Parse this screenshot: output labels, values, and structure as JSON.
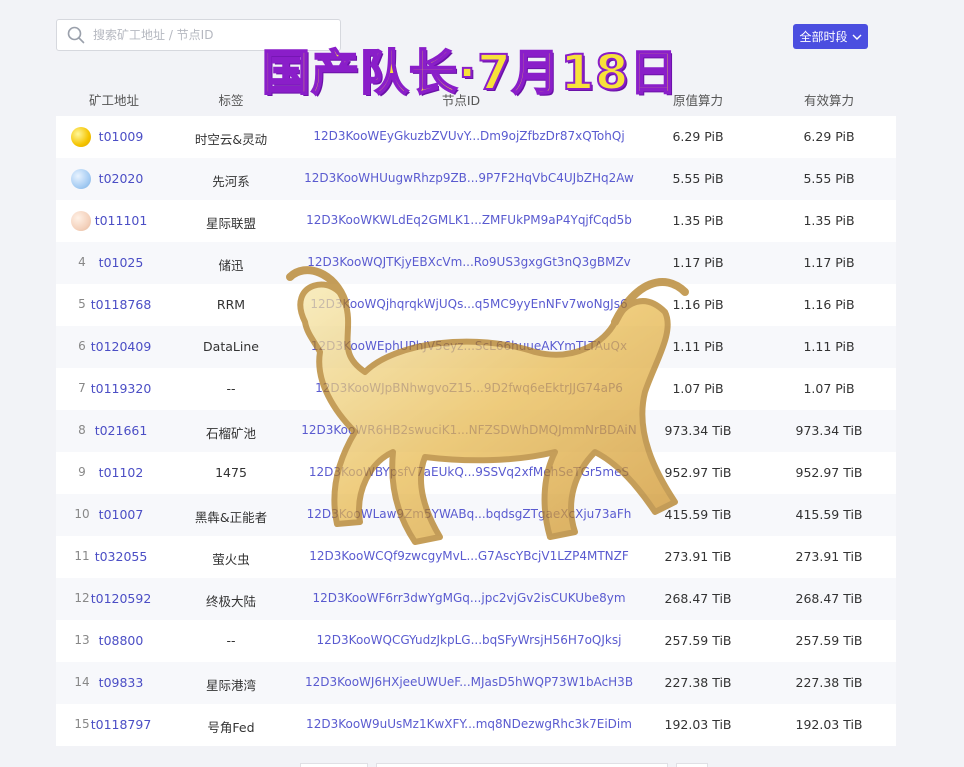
{
  "search": {
    "placeholder": "搜索矿工地址 / 节点ID"
  },
  "overlay_title": "国产队长·7月18日",
  "period_button": {
    "label": "全部时段"
  },
  "columns": {
    "miner": "矿工地址",
    "tag": "标签",
    "node": "节点ID",
    "raw": "原值算力",
    "effective": "有效算力"
  },
  "rows": [
    {
      "rank": "1",
      "miner": "t01009",
      "tag": "时空云&灵动",
      "node": "12D3KooWEyGkuzbZVUvY...Dm9ojZfbzDr87xQTohQj",
      "raw": "6.29 PiB",
      "effective": "6.29 PiB"
    },
    {
      "rank": "2",
      "miner": "t02020",
      "tag": "先河系",
      "node": "12D3KooWHUugwRhzp9ZB...9P7F2HqVbC4UJbZHq2Aw",
      "raw": "5.55 PiB",
      "effective": "5.55 PiB"
    },
    {
      "rank": "3",
      "miner": "t011101",
      "tag": "星际联盟",
      "node": "12D3KooWKWLdEq2GMLK1...ZMFUkPM9aP4YqjfCqd5b",
      "raw": "1.35 PiB",
      "effective": "1.35 PiB"
    },
    {
      "rank": "4",
      "miner": "t01025",
      "tag": "储迅",
      "node": "12D3KooWQJTKjyEBXcVm...Ro9US3gxgGt3nQ3gBMZv",
      "raw": "1.17 PiB",
      "effective": "1.17 PiB"
    },
    {
      "rank": "5",
      "miner": "t0118768",
      "tag": "RRM",
      "node": "12D3KooWQjhqrqkWjUQs...q5MC9yyEnNFv7woNgJs6",
      "raw": "1.16 PiB",
      "effective": "1.16 PiB"
    },
    {
      "rank": "6",
      "miner": "t0120409",
      "tag": "DataLine",
      "node": "12D3KooWEphUPhJV5eyz...ScL66huueAKYmTLTAuQx",
      "raw": "1.11 PiB",
      "effective": "1.11 PiB"
    },
    {
      "rank": "7",
      "miner": "t0119320",
      "tag": "--",
      "node": "12D3KooWJpBNhwgvoZ15...9D2fwq6eEktrJJG74aP6",
      "raw": "1.07 PiB",
      "effective": "1.07 PiB"
    },
    {
      "rank": "8",
      "miner": "t021661",
      "tag": "石榴矿池",
      "node": "12D3KooWR6HB2swuciK1...NFZSDWhDMQJmmNrBDAiN",
      "raw": "973.34 TiB",
      "effective": "973.34 TiB"
    },
    {
      "rank": "9",
      "miner": "t01102",
      "tag": "1475",
      "node": "12D3KooWBYpsfV7aEUkQ...9SSVq2xfMehSeTGr5meS",
      "raw": "952.97 TiB",
      "effective": "952.97 TiB"
    },
    {
      "rank": "10",
      "miner": "t01007",
      "tag": "黑犇&正能者",
      "node": "12D3KooWLaw9Zm5YWABq...bqdsgZTgaeXcXju73aFh",
      "raw": "415.59 TiB",
      "effective": "415.59 TiB"
    },
    {
      "rank": "11",
      "miner": "t032055",
      "tag": "萤火虫",
      "node": "12D3KooWCQf9zwcgyMvL...G7AscYBcjV1LZP4MTNZF",
      "raw": "273.91 TiB",
      "effective": "273.91 TiB"
    },
    {
      "rank": "12",
      "miner": "t0120592",
      "tag": "终极大陆",
      "node": "12D3KooWF6rr3dwYgMGq...jpc2vjGv2isCUKUbe8ym",
      "raw": "268.47 TiB",
      "effective": "268.47 TiB"
    },
    {
      "rank": "13",
      "miner": "t08800",
      "tag": "--",
      "node": "12D3KooWQCGYudzJkpLG...bqSFyWrsjH56H7oQJksj",
      "raw": "257.59 TiB",
      "effective": "257.59 TiB"
    },
    {
      "rank": "14",
      "miner": "t09833",
      "tag": "星际港湾",
      "node": "12D3KooWJ6HXjeeUWUeF...MJasD5hWQP73W1bAcH3B",
      "raw": "227.38 TiB",
      "effective": "227.38 TiB"
    },
    {
      "rank": "15",
      "miner": "t0118797",
      "tag": "号角Fed",
      "node": "12D3KooW9uUsMz1KwXFY...mq8NDezwgRhc3k7EiDim",
      "raw": "192.03 TiB",
      "effective": "192.03 TiB"
    }
  ],
  "colors": {
    "accent": "#4b4ee0",
    "link": "#4b4ec5",
    "overlay_fill": "#f7e23a",
    "overlay_stroke": "#8a1ec9"
  }
}
